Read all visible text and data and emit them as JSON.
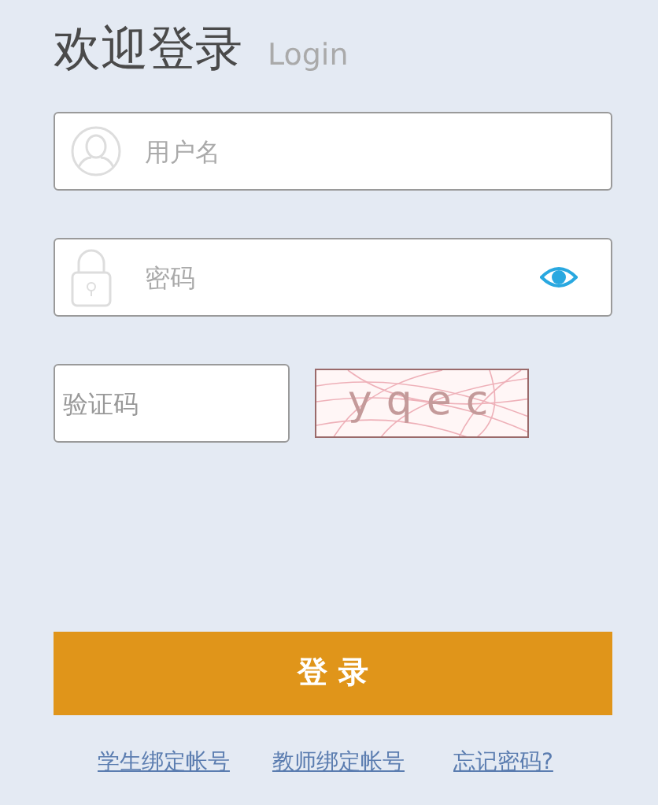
{
  "title": "欢迎登录",
  "subtitle": "Login",
  "username": {
    "placeholder": "用户名"
  },
  "password": {
    "placeholder": "密码"
  },
  "captcha": {
    "placeholder": "验证码",
    "code": "yqec"
  },
  "login_button": "登 录",
  "links": [
    "学生绑定帐号",
    "教师绑定帐号",
    "忘记密码?"
  ]
}
